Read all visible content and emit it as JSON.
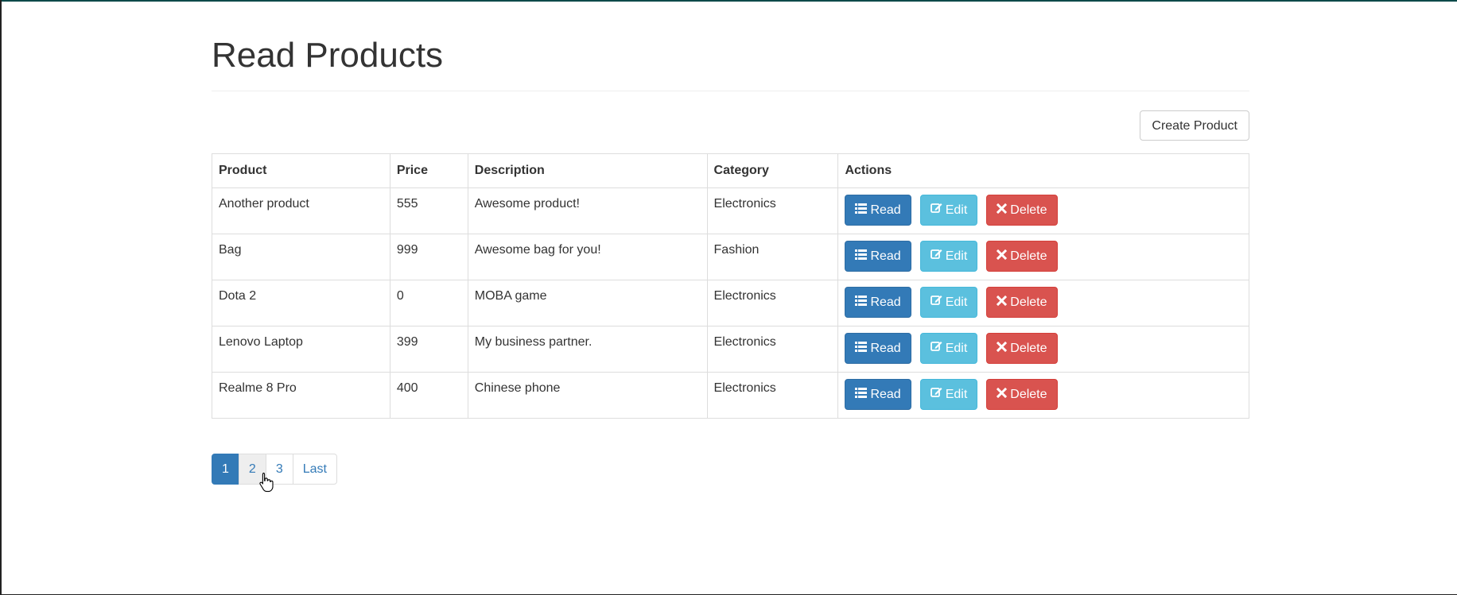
{
  "page": {
    "title": "Read Products"
  },
  "toolbar": {
    "create_label": "Create Product"
  },
  "table": {
    "headers": [
      "Product",
      "Price",
      "Description",
      "Category",
      "Actions"
    ],
    "rows": [
      {
        "product": "Another product",
        "price": "555",
        "description": "Awesome product!",
        "category": "Electronics"
      },
      {
        "product": "Bag",
        "price": "999",
        "description": "Awesome bag for you!",
        "category": "Fashion"
      },
      {
        "product": "Dota 2",
        "price": "0",
        "description": "MOBA game",
        "category": "Electronics"
      },
      {
        "product": "Lenovo Laptop",
        "price": "399",
        "description": "My business partner.",
        "category": "Electronics"
      },
      {
        "product": "Realme 8 Pro",
        "price": "400",
        "description": "Chinese phone",
        "category": "Electronics"
      }
    ],
    "actions": {
      "read_label": "Read",
      "edit_label": "Edit",
      "delete_label": "Delete"
    }
  },
  "pagination": {
    "pages": [
      "1",
      "2",
      "3"
    ],
    "last_label": "Last",
    "current": "1"
  },
  "icons": {
    "read": "list-icon",
    "edit": "edit-icon",
    "delete": "close-icon"
  },
  "colors": {
    "primary": "#337ab7",
    "info": "#5bc0de",
    "danger": "#d9534f"
  }
}
